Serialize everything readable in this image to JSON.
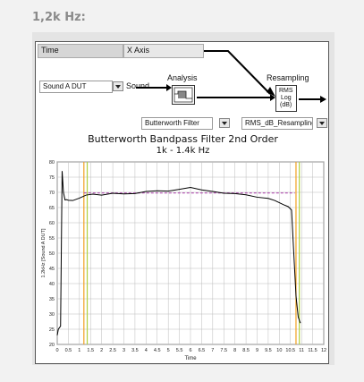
{
  "heading": "1,2k Hz:",
  "block_diagram": {
    "time_label": "Time",
    "x_axis_label": "X Axis",
    "sound_select_value": "Sound A DUT",
    "sound_label": "Sound",
    "analysis_label": "Analysis",
    "resampling_label": "Resampling",
    "filter_select_value": "Butterworth Filter",
    "resampling_select_value": "RMS_dB_Resampling",
    "rms_node_lines": [
      "RMS",
      "Log",
      "(dB)"
    ]
  },
  "colors": {
    "signal": "#000000",
    "threshold": "#b04fb0",
    "marker_orange": "#f0a020",
    "marker_green": "#b0d040",
    "grid": "#bbbbbb"
  },
  "chart_data": {
    "type": "line",
    "title": "Butterworth Bandpass Filter 2nd Order",
    "subtitle": "1k - 1.4k Hz",
    "xlabel": "Time",
    "ylabel": "1.2kHz [Sound A DUT]",
    "xlim": [
      0,
      12
    ],
    "ylim": [
      20,
      80
    ],
    "xticks": [
      "0",
      "0.5",
      "1",
      "1.5",
      "2",
      "2.5",
      "3",
      "3.5",
      "4",
      "4.5",
      "5",
      "5.5",
      "6",
      "6.5",
      "7",
      "7.5",
      "8",
      "8.5",
      "9",
      "9.5",
      "10",
      "10.5",
      "11",
      "11.5",
      "12"
    ],
    "yticks": [
      "20",
      "25",
      "30",
      "35",
      "40",
      "45",
      "50",
      "55",
      "60",
      "65",
      "70",
      "75",
      "80"
    ],
    "grid": true,
    "series": [
      {
        "x": [
          0,
          0.05,
          0.15,
          0.22,
          0.28,
          0.35,
          0.42,
          0.5,
          0.7,
          1,
          1.3,
          1.6,
          2,
          2.5,
          3,
          3.5,
          4,
          4.5,
          5,
          5.5,
          6,
          6.5,
          7,
          7.5,
          8,
          8.5,
          9,
          9.5,
          9.8,
          10,
          10.2,
          10.4,
          10.55,
          10.65,
          10.75,
          10.85,
          10.95
        ],
        "y": [
          23,
          25,
          26,
          77,
          70,
          67.5,
          67.6,
          67.4,
          67.3,
          68.1,
          69.1,
          69.4,
          69.1,
          69.7,
          69.5,
          69.6,
          70.3,
          70.5,
          70.4,
          71.0,
          71.6,
          70.8,
          70.3,
          69.7,
          69.6,
          69.2,
          68.4,
          68.0,
          67.3,
          66.6,
          65.9,
          65.3,
          64.2,
          50,
          36,
          29,
          27
        ]
      },
      {
        "x": [
          1.2,
          10.7
        ],
        "y": [
          69.8,
          69.8
        ]
      }
    ],
    "markers_x": [
      1.2,
      1.35,
      10.75,
      10.9
    ]
  }
}
